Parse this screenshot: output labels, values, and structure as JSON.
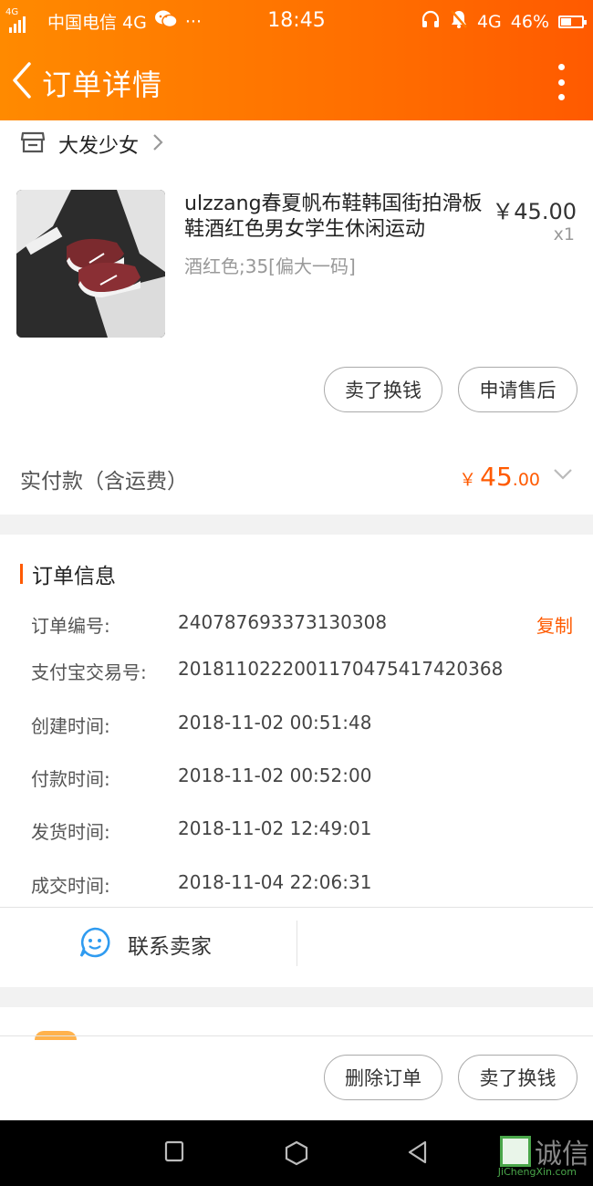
{
  "status_bar": {
    "net_tag": "4G",
    "carrier": "中国电信 4G",
    "more_dots": "···",
    "time": "18:45",
    "network": "4G",
    "battery": "46%",
    "battery_level": 0.46
  },
  "nav": {
    "title": "订单详情"
  },
  "shop": {
    "name": "大发少女"
  },
  "product": {
    "name": "ulzzang春夏帆布鞋韩国街拍滑板鞋酒红色男女学生休闲运动",
    "variant": "酒红色;35[偏大一码]",
    "price": "￥45.00",
    "quantity": "x1"
  },
  "item_actions": {
    "sell_label": "卖了换钱",
    "after_sale_label": "申请售后"
  },
  "payment": {
    "label": "实付款（含运费）",
    "currency": "￥",
    "amount_int": "45",
    "amount_dec": ".00"
  },
  "order_info": {
    "title": "订单信息",
    "copy_label": "复制",
    "rows": [
      {
        "label": "订单编号:",
        "value": "240787693373130308"
      },
      {
        "label": "支付宝交易号:",
        "value": "2018110222001170475417420368"
      },
      {
        "label": "创建时间:",
        "value": "2018-11-02 00:51:48"
      },
      {
        "label": "付款时间:",
        "value": "2018-11-02 00:52:00"
      },
      {
        "label": "发货时间:",
        "value": "2018-11-02 12:49:01"
      },
      {
        "label": "成交时间:",
        "value": "2018-11-04 22:06:31"
      }
    ]
  },
  "contact": {
    "label": "联系卖家"
  },
  "bottom_actions": {
    "delete_label": "删除订单",
    "sell_label": "卖了换钱"
  },
  "watermark": {
    "text": "诚信",
    "sub": "JiChengXin.com"
  },
  "colors": {
    "accent": "#ff5a00",
    "header_start": "#ff8a00",
    "header_end": "#ff5a00"
  }
}
